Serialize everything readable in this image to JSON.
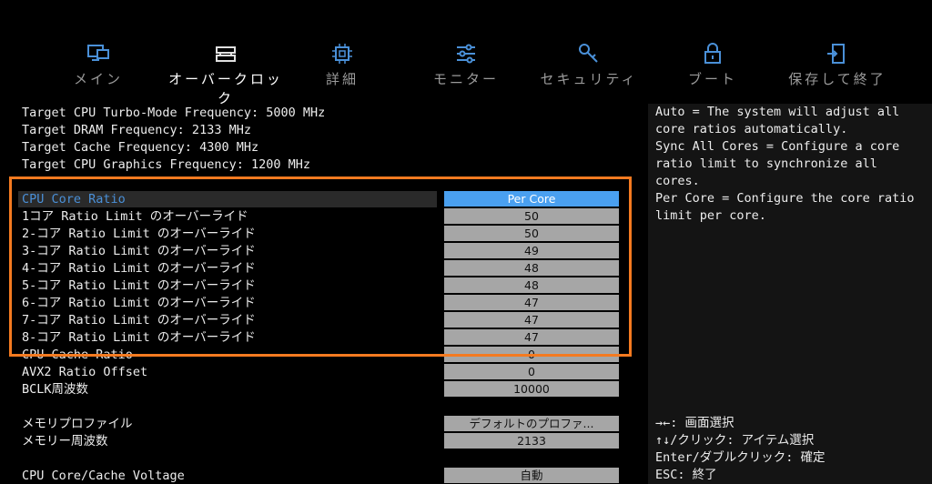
{
  "nav": {
    "items": [
      {
        "label": "メイン",
        "icon": "monitor-icon"
      },
      {
        "label": "オーバークロック",
        "icon": "memory-module-icon"
      },
      {
        "label": "詳細",
        "icon": "chip-icon"
      },
      {
        "label": "モニター",
        "icon": "sliders-icon"
      },
      {
        "label": "セキュリティ",
        "icon": "key-icon"
      },
      {
        "label": "ブート",
        "icon": "lock-icon"
      },
      {
        "label": "保存して終了",
        "icon": "exit-door-icon"
      }
    ],
    "active_index": 1
  },
  "info_lines": [
    "Target CPU Turbo-Mode Frequency: 5000 MHz",
    "Target DRAM Frequency: 2133 MHz",
    "Target Cache Frequency: 4300 MHz",
    "Target CPU Graphics Frequency: 1200 MHz"
  ],
  "settings": [
    {
      "label": "CPU Core Ratio",
      "value": "Per Core"
    },
    {
      "label": "1コア Ratio Limit のオーバーライド",
      "value": "50"
    },
    {
      "label": "2-コア Ratio Limit のオーバーライド",
      "value": "50"
    },
    {
      "label": "3-コア Ratio Limit のオーバーライド",
      "value": "49"
    },
    {
      "label": "4-コア Ratio Limit のオーバーライド",
      "value": "48"
    },
    {
      "label": "5-コア Ratio Limit のオーバーライド",
      "value": "48"
    },
    {
      "label": "6-コア Ratio Limit のオーバーライド",
      "value": "47"
    },
    {
      "label": "7-コア Ratio Limit のオーバーライド",
      "value": "47"
    },
    {
      "label": "8-コア Ratio Limit のオーバーライド",
      "value": "47"
    },
    {
      "label": "CPU Cache Ratio",
      "value": "0"
    },
    {
      "label": "AVX2 Ratio Offset",
      "value": "0"
    },
    {
      "label": "BCLK周波数",
      "value": "10000"
    },
    {
      "label": "メモリプロファイル",
      "value": "デフォルトのプロファ..."
    },
    {
      "label": "メモリー周波数",
      "value": "2133"
    },
    {
      "label": "CPU Core/Cache Voltage",
      "value": "自動"
    }
  ],
  "help_text": "Auto = The system will adjust all\ncore ratios automatically.\nSync All Cores = Configure a core\nratio limit to synchronize all\ncores.\nPer Core = Configure the core ratio\nlimit per core.",
  "key_help": [
    "→←: 画面選択",
    "↑↓/クリック: アイテム選択",
    "Enter/ダブルクリック: 確定",
    "ESC: 終了"
  ],
  "colors": {
    "accent": "#4aa0f0",
    "highlight_border": "#f47a20",
    "icon": "#4a90d8"
  }
}
